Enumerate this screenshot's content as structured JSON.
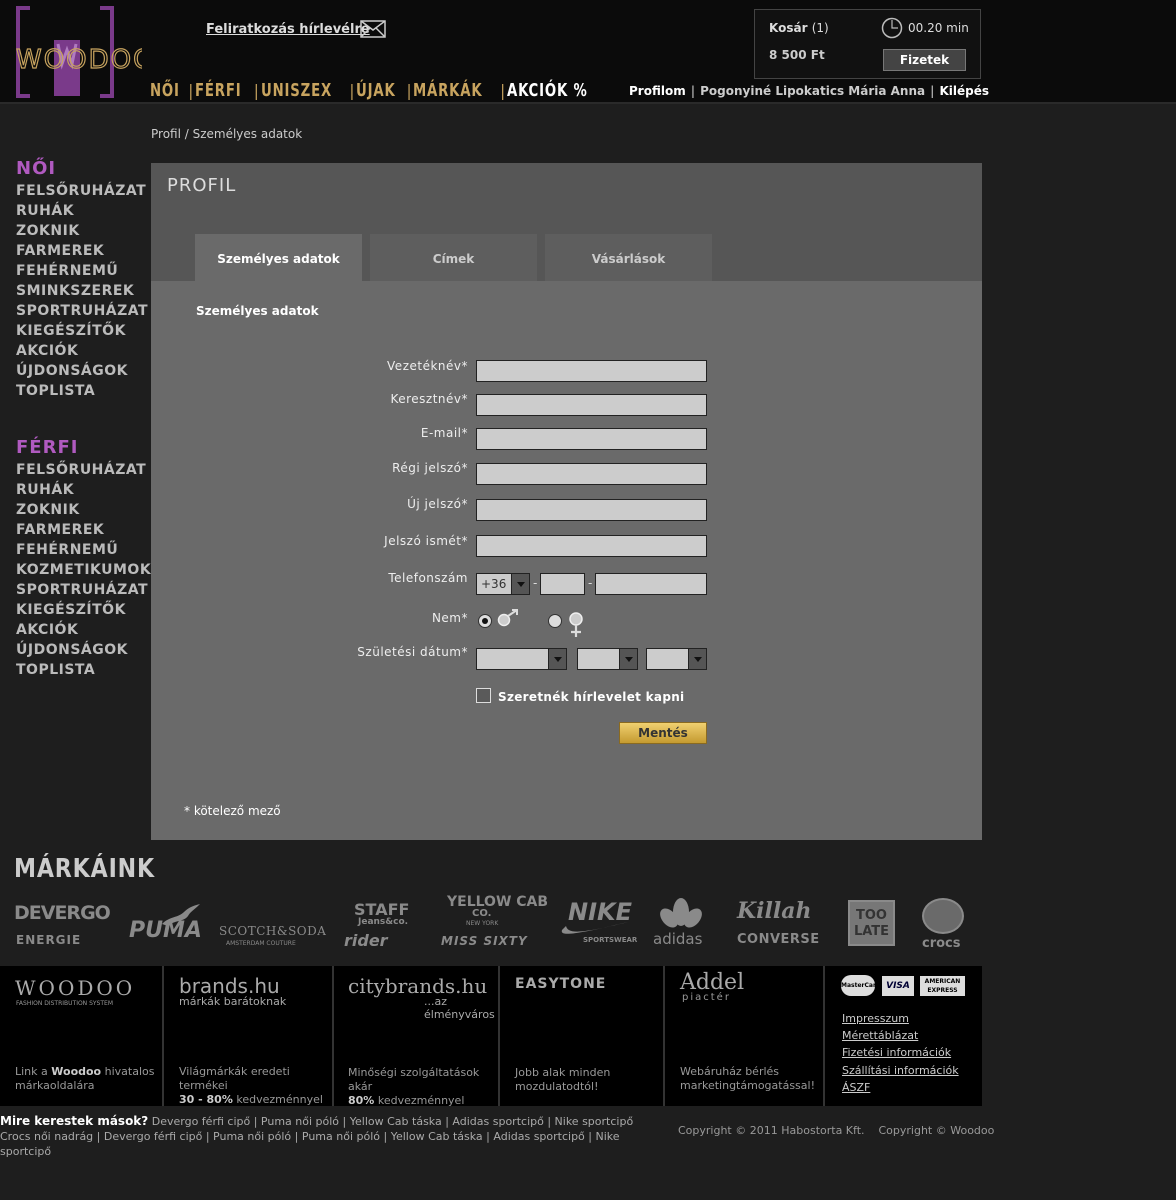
{
  "header": {
    "logo_text": "WOODOO",
    "newsletter_link": "Feliratkozás hírlevélre",
    "cart": {
      "label": "Kosár",
      "count": "(1)",
      "price": "8 500 Ft",
      "timer": "00.20 min",
      "pay_button": "Fizetek"
    },
    "nav": [
      "NŐI",
      "FÉRFI",
      "UNISZEX",
      "ÚJAK",
      "MÁRKÁK",
      "AKCIÓK %"
    ],
    "user_nav": {
      "profile": "Profilom",
      "name": "Pogonyiné Lipokatics Mária Anna",
      "logout": "Kilépés"
    }
  },
  "breadcrumb": "Profil / Személyes adatok",
  "sidebar": {
    "women": {
      "title": "NŐI",
      "items": [
        "FELSŐRUHÁZAT",
        "RUHÁK",
        "ZOKNIK",
        "FARMEREK",
        "FEHÉRNEMŰ",
        "SMINKSZEREK",
        "SPORTRUHÁZAT",
        "KIEGÉSZÍTŐK",
        "AKCIÓK",
        "ÚJDONSÁGOK",
        "TOPLISTA"
      ]
    },
    "men": {
      "title": "FÉRFI",
      "items": [
        "FELSŐRUHÁZAT",
        "RUHÁK",
        "ZOKNIK",
        "FARMEREK",
        "FEHÉRNEMŰ",
        "KOZMETIKUMOK",
        "SPORTRUHÁZAT",
        "KIEGÉSZÍTŐK",
        "AKCIÓK",
        "ÚJDONSÁGOK",
        "TOPLISTA"
      ]
    }
  },
  "profile": {
    "title": "PROFIL",
    "tabs": [
      "Személyes adatok",
      "Címek",
      "Vásárlások"
    ],
    "section_title": "Személyes adatok",
    "labels": {
      "last_name": "Vezetéknév*",
      "first_name": "Keresztnév*",
      "email": "E-mail*",
      "old_password": "Régi jelszó*",
      "new_password": "Új jelszó*",
      "password_again": "Jelszó ismét*",
      "phone": "Telefonszám",
      "gender": "Nem*",
      "birth_date": "Születési dátum*"
    },
    "values": {
      "last_name": "",
      "first_name": "",
      "email": "",
      "phone_prefix": "+36",
      "gender": "male"
    },
    "newsletter_checkbox": "Szeretnék hírlevelet kapni",
    "save_button": "Mentés",
    "required_note": "* kötelező mező"
  },
  "brands": {
    "title": "MÁRKÁINK",
    "names": [
      "DEVERGO",
      "ENERGIE",
      "PUMA",
      "SCOTCH&SODA",
      "AMSTERDAM COUTURE",
      "STAFF",
      "Jeans&co.",
      "rider",
      "YELLOW CAB",
      "CO.",
      "NEW YORK",
      "MISS SIXTY",
      "NIKE",
      "SPORTSWEAR",
      "adidas",
      "Killah",
      "CONVERSE",
      "TOO LATE",
      "crocs"
    ]
  },
  "footer": {
    "cols": [
      {
        "logo": "WOODOO",
        "sub": "FASHION DISTRIBUTION SYSTEM",
        "text_pre": "Link a ",
        "text_bold": "Woodoo",
        "text_post": " hivatalos márkaoldalára"
      },
      {
        "logo": "brands.hu",
        "sub": "márkák barátoknak",
        "text_pre": "Világmárkák eredeti termékei",
        "text_bold": "30 - 80%",
        "text_post": " kedvezménnyel"
      },
      {
        "logo": "citybrands.hu",
        "sub": "...az élményváros",
        "text_pre": "Minőségi szolgáltatások akár",
        "text_bold": "80%",
        "text_post": " kedvezménnyel"
      },
      {
        "logo": "EASYTONE",
        "text_pre": "Jobb alak minden mozdulatodtól!"
      },
      {
        "logo": "Addel",
        "sub": "piactér",
        "text_pre": "Webáruház bérlés marketingtámogatással!"
      }
    ],
    "cards": [
      "MasterCard",
      "VISA",
      "AMERICAN EXPRESS"
    ],
    "links": [
      "Impresszum",
      "Mérettáblázat",
      "Fizetési információk",
      "Szállítási információk",
      "ÁSZF"
    ]
  },
  "bottom": {
    "question": "Mire kerestek mások?",
    "line1": [
      "Devergo férfi cipő",
      "Puma női póló",
      "Yellow Cab táska",
      "Adidas sportcipő",
      "Nike sportcipő"
    ],
    "line2": [
      "Crocs női nadrág",
      "Devergo férfi cipő",
      "Puma női póló",
      "Puma női póló",
      "Yellow Cab táska",
      "Adidas sportcipő",
      "Nike sportcipő"
    ],
    "copyright": "Copyright © 2011 Habostorta Kft.    Copyright © Woodoo"
  }
}
